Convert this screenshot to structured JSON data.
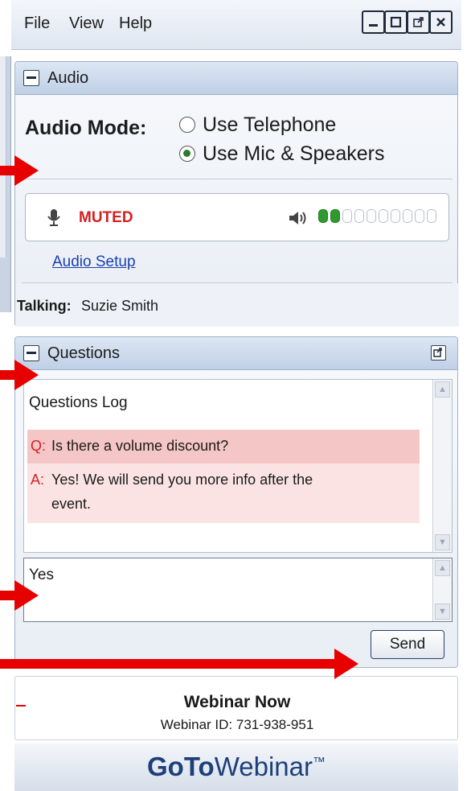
{
  "menu": {
    "file": "File",
    "view": "View",
    "help": "Help"
  },
  "audio": {
    "title": "Audio",
    "mode_label": "Audio Mode:",
    "options": [
      {
        "label": "Use Telephone",
        "selected": false
      },
      {
        "label": "Use Mic & Speakers",
        "selected": true
      }
    ],
    "mic_status": "MUTED",
    "speaker_level_filled": 2,
    "speaker_level_total": 10,
    "setup_link": "Audio Setup",
    "talking_label": "Talking:",
    "talking_name": "Suzie Smith"
  },
  "questions": {
    "title": "Questions",
    "log_title": "Questions Log",
    "q_prefix": "Q:",
    "question": "Is there a volume discount?",
    "a_prefix": "A:",
    "answer_line1": "Yes! We will send you more info after the",
    "answer_line2": "event.",
    "input_value": "Yes",
    "send_label": "Send"
  },
  "webinar": {
    "name": "Webinar Now",
    "id_text": "Webinar ID: 731-938-951"
  },
  "brand": {
    "goto": "GoTo",
    "webinar": "Webinar",
    "tm": "™"
  },
  "colors": {
    "accent_arrow": "#e60000",
    "muted_red": "#d42020",
    "meter_green": "#2e9a2e",
    "brand_blue": "#1d3f7a"
  }
}
